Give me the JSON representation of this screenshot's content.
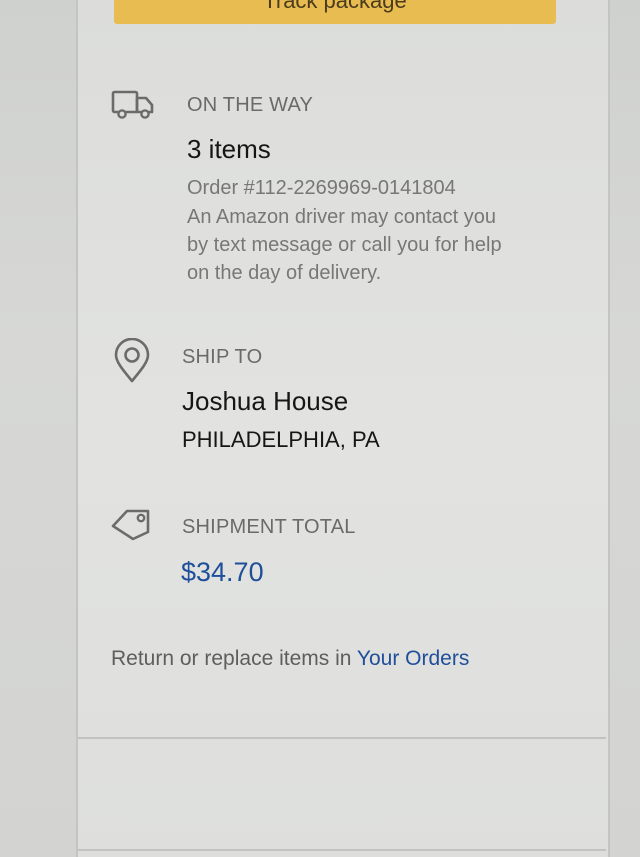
{
  "track_button": {
    "label": "Track package"
  },
  "delivery": {
    "icon": "delivery-truck-icon",
    "heading": "ON THE WAY",
    "item_count": "3 items",
    "order_number": "Order #112-2269969-0141804",
    "notice_lines": [
      "An Amazon driver may contact you",
      "by text message or call you for help",
      "on the day of delivery."
    ]
  },
  "ship_to": {
    "icon": "location-pin-icon",
    "heading": "SHIP TO",
    "name": "Joshua House",
    "city": "PHILADELPHIA, PA"
  },
  "shipment_total": {
    "icon": "price-tag-icon",
    "heading": "SHIPMENT TOTAL",
    "amount": "$34.70"
  },
  "footer": {
    "text": "Return or replace items in ",
    "link": "Your Orders"
  },
  "colors": {
    "accent_button": "#e9bc52",
    "link": "#1f4f9a",
    "heading": "#6a6a6a"
  }
}
